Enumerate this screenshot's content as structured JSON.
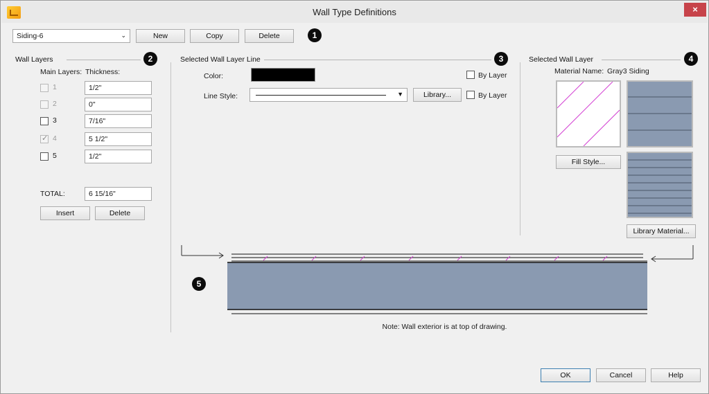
{
  "window": {
    "title": "Wall Type Definitions",
    "close_label": "×"
  },
  "top": {
    "wall_type": "Siding-6",
    "new_label": "New",
    "copy_label": "Copy",
    "delete_label": "Delete",
    "callout": "1"
  },
  "wall_layers": {
    "title": "Wall Layers",
    "callout": "2",
    "main_layers_header": "Main Layers:",
    "thickness_header": "Thickness:",
    "layers": [
      {
        "num": "1",
        "thickness": "1/2\"",
        "checked": false,
        "enabled": false
      },
      {
        "num": "2",
        "thickness": "0\"",
        "checked": false,
        "enabled": false
      },
      {
        "num": "3",
        "thickness": "7/16\"",
        "checked": false,
        "enabled": true
      },
      {
        "num": "4",
        "thickness": "5 1/2\"",
        "checked": true,
        "enabled": false
      },
      {
        "num": "5",
        "thickness": "1/2\"",
        "checked": false,
        "enabled": true
      }
    ],
    "total_label": "TOTAL:",
    "total_value": "6 15/16\"",
    "insert_label": "Insert",
    "delete_label": "Delete"
  },
  "layer_line": {
    "title": "Selected Wall Layer Line",
    "callout": "3",
    "color_label": "Color:",
    "color_value": "#000000",
    "by_layer_label": "By Layer",
    "line_style_label": "Line Style:",
    "library_label": "Library...",
    "by_layer_label_2": "By Layer"
  },
  "wall_layer": {
    "title": "Selected Wall Layer",
    "callout": "4",
    "material_name_label": "Material Name:",
    "material_name_value": "Gray3 Siding",
    "fill_style_label": "Fill Style...",
    "library_material_label": "Library Material...",
    "fill_color": "#d23fd2",
    "material_color": "#8a9ab1"
  },
  "preview": {
    "callout": "5",
    "note": "Note: Wall exterior is at top of drawing.",
    "wall_color": "#8a9ab1"
  },
  "footer": {
    "ok_label": "OK",
    "cancel_label": "Cancel",
    "help_label": "Help"
  }
}
